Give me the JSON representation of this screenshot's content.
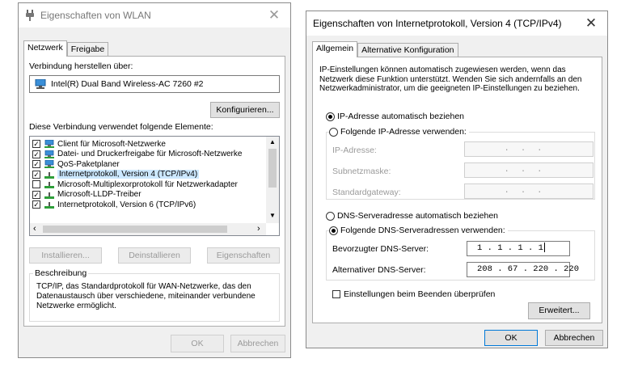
{
  "wlan": {
    "title": "Eigenschaften von WLAN",
    "tabs": [
      "Netzwerk",
      "Freigabe"
    ],
    "connect_label": "Verbindung herstellen über:",
    "adapter": "Intel(R) Dual Band Wireless-AC 7260 #2",
    "configure": "Konfigurieren...",
    "elements_label": "Diese Verbindung verwendet folgende Elemente:",
    "items": [
      {
        "label": "Client für Microsoft-Netzwerke",
        "checked": true,
        "icon": "network-icon"
      },
      {
        "label": "Datei- und Druckerfreigabe für Microsoft-Netzwerke",
        "checked": true,
        "icon": "network-icon"
      },
      {
        "label": "QoS-Paketplaner",
        "checked": true,
        "icon": "network-icon"
      },
      {
        "label": "Internetprotokoll, Version 4 (TCP/IPv4)",
        "checked": true,
        "icon": "protocol-icon",
        "selected": true
      },
      {
        "label": "Microsoft-Multiplexorprotokoll für Netzwerkadapter",
        "checked": false,
        "icon": "protocol-icon"
      },
      {
        "label": "Microsoft-LLDP-Treiber",
        "checked": true,
        "icon": "protocol-icon"
      },
      {
        "label": "Internetprotokoll, Version 6 (TCP/IPv6)",
        "checked": true,
        "icon": "protocol-icon"
      }
    ],
    "btn_install": "Installieren...",
    "btn_uninstall": "Deinstallieren",
    "btn_props": "Eigenschaften",
    "desc_label": "Beschreibung",
    "desc_text": "TCP/IP, das Standardprotokoll für WAN-Netzwerke, das den Datenaustausch über verschiedene, miteinander verbundene Netzwerke ermöglicht.",
    "ok": "OK",
    "cancel": "Abbrechen"
  },
  "ipv4": {
    "title": "Eigenschaften von Internetprotokoll, Version 4 (TCP/IPv4)",
    "tabs": [
      "Allgemein",
      "Alternative Konfiguration"
    ],
    "intro": "IP-Einstellungen können automatisch zugewiesen werden, wenn das Netzwerk diese Funktion unterstützt. Wenden Sie sich andernfalls an den Netzwerkadministrator, um die geeigneten IP-Einstellungen zu beziehen.",
    "radio_ip_auto": "IP-Adresse automatisch beziehen",
    "radio_ip_manual": "Folgende IP-Adresse verwenden:",
    "ip_label": "IP-Adresse:",
    "subnet_label": "Subnetzmaske:",
    "gateway_label": "Standardgateway:",
    "empty_ip": "...",
    "radio_dns_auto": "DNS-Serveradresse automatisch beziehen",
    "radio_dns_manual": "Folgende DNS-Serveradressen verwenden:",
    "dns_pref_label": "Bevorzugter DNS-Server:",
    "dns_pref_value": "1 . 1 . 1 . 1",
    "dns_alt_label": "Alternativer DNS-Server:",
    "dns_alt_value": "208 . 67 . 220 . 220",
    "validate": "Einstellungen beim Beenden überprüfen",
    "advanced": "Erweitert...",
    "ok": "OK",
    "cancel": "Abbrechen"
  },
  "colors": {
    "accent": "#0078d7",
    "selection": "#cce8ff",
    "network_icon": "#3a8fd8",
    "protocol_icon": "#2e9e3a"
  }
}
